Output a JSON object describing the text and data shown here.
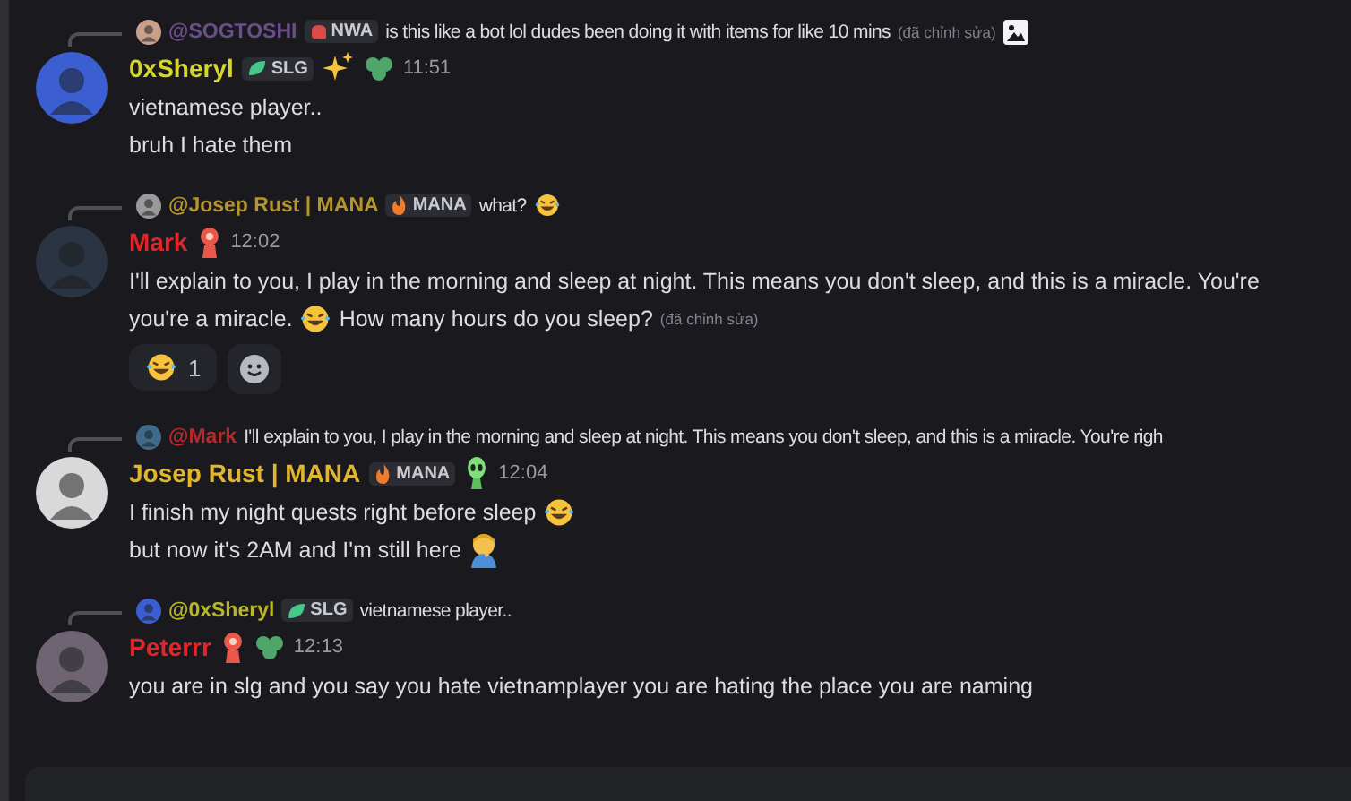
{
  "messages": [
    {
      "reply": {
        "author": "@SOGTOSHI",
        "color": "#6b4f8c",
        "tag": {
          "kind": "fist",
          "label": "NWA"
        },
        "content": [
          {
            "kind": "text",
            "text": "is this like a bot lol dudes been doing it with items for like 10 mins"
          },
          {
            "kind": "edited",
            "text": "(đã chỉnh sửa)"
          },
          {
            "kind": "image"
          }
        ]
      },
      "author": "0xSheryl",
      "color": "#d6d62a",
      "tag": {
        "kind": "leaf",
        "label": "SLG"
      },
      "badges": [
        {
          "kind": "sparkles"
        },
        {
          "kind": "clover"
        }
      ],
      "timestamp": "11:51",
      "lines": [
        [
          {
            "kind": "text",
            "text": "vietnamese player.."
          }
        ],
        [
          {
            "kind": "text",
            "text": "bruh I hate them"
          }
        ]
      ]
    },
    {
      "reply": {
        "author": "@Josep Rust | MANA",
        "color": "#b8952c",
        "tag": {
          "kind": "flame",
          "label": "MANA"
        },
        "content": [
          {
            "kind": "text",
            "text": "what?"
          },
          {
            "kind": "laughing"
          }
        ]
      },
      "author": "Mark",
      "color": "#e0262a",
      "badges": [
        {
          "kind": "red-figure"
        }
      ],
      "timestamp": "12:02",
      "lines": [
        [
          {
            "kind": "text",
            "text": "I'll explain to you, I play in the morning and sleep at night. This means you don't sleep, and this is a miracle. You're"
          }
        ],
        [
          {
            "kind": "text",
            "text": "you're a miracle."
          },
          {
            "kind": "laughing"
          },
          {
            "kind": "text",
            "text": "How many hours do you sleep?"
          },
          {
            "kind": "edited",
            "text": "(đã chỉnh sửa)"
          }
        ]
      ],
      "reactions": [
        {
          "kind": "laughing",
          "count": "1",
          "selected": false
        }
      ]
    },
    {
      "reply": {
        "author": "@Mark",
        "color": "#b52a2a",
        "content": [
          {
            "kind": "text",
            "text": "I'll explain to you, I play in the morning and sleep at night. This means you don't sleep, and this is a miracle. You're righ"
          }
        ]
      },
      "author": "Josep Rust | MANA",
      "color": "#e2b52e",
      "tag": {
        "kind": "flame",
        "label": "MANA"
      },
      "badges": [
        {
          "kind": "green-figure"
        }
      ],
      "timestamp": "12:04",
      "lines": [
        [
          {
            "kind": "text",
            "text": "I finish my night quests right before sleep"
          },
          {
            "kind": "laughing"
          }
        ],
        [
          {
            "kind": "text",
            "text": "but now it's 2AM and I'm still here"
          },
          {
            "kind": "facepalm"
          }
        ]
      ]
    },
    {
      "reply": {
        "author": "@0xSheryl",
        "color": "#b8b82a",
        "tag": {
          "kind": "leaf",
          "label": "SLG"
        },
        "content": [
          {
            "kind": "text",
            "text": "vietnamese player.."
          }
        ]
      },
      "author": "Peterrr",
      "color": "#e0262a",
      "badges": [
        {
          "kind": "red-figure"
        },
        {
          "kind": "clover"
        }
      ],
      "timestamp": "12:13",
      "lines": [
        [
          {
            "kind": "text",
            "text": "you are in slg and you say you hate vietnamplayer you are hating the place you are naming"
          }
        ]
      ]
    }
  ]
}
